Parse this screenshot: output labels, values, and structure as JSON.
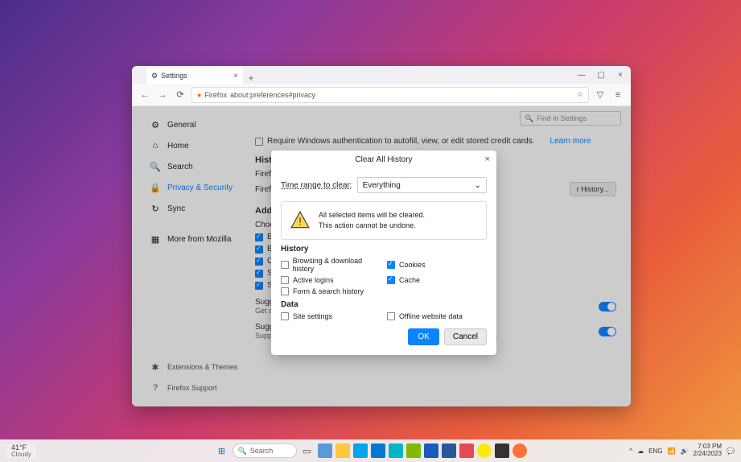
{
  "browser": {
    "tab_title": "Settings",
    "url_prefix": "Firefox",
    "url": "about:preferences#privacy",
    "find_placeholder": "Find in Settings"
  },
  "sidebar": {
    "items": [
      {
        "icon": "⚙",
        "label": "General"
      },
      {
        "icon": "⌂",
        "label": "Home"
      },
      {
        "icon": "🔍",
        "label": "Search"
      },
      {
        "icon": "🔒",
        "label": "Privacy & Security"
      },
      {
        "icon": "↻",
        "label": "Sync"
      },
      {
        "icon": "▦",
        "label": "More from Mozilla"
      }
    ],
    "footer": [
      {
        "icon": "✱",
        "label": "Extensions & Themes"
      },
      {
        "icon": "?",
        "label": "Firefox Support"
      }
    ]
  },
  "main": {
    "cc_label": "Require Windows authentication to autofill, view, or edit stored credit cards.",
    "learn_more": "Learn more",
    "history_heading": "Histo",
    "firefox_line1": "Firefo",
    "firefox_line2": "Firefo",
    "clear_history_btn": "r History...",
    "addr_heading": "Addr",
    "choose_line": "Choo",
    "chk1": "B",
    "chk2": "B",
    "chk3": "O",
    "chk4": "S",
    "chk5": "S",
    "sugg_heading": "Sugg",
    "sugg_desc": "Get suggestions from Firefox related to your search.",
    "sponsors_heading": "Suggestions from sponsors",
    "sponsors_desc": "Support the development of Firefox with occasional sponsored suggestions."
  },
  "dialog": {
    "title": "Clear All History",
    "range_label": "Time range to clear:",
    "range_value": "Everything",
    "warn_line1": "All selected items will be cleared.",
    "warn_line2": "This action cannot be undone.",
    "history_heading": "History",
    "chk_browsing": "Browsing & download history",
    "chk_cookies": "Cookies",
    "chk_logins": "Active logins",
    "chk_cache": "Cache",
    "chk_form": "Form & search history",
    "data_heading": "Data",
    "chk_site": "Site settings",
    "chk_offline": "Offline website data",
    "ok": "OK",
    "cancel": "Cancel"
  },
  "taskbar": {
    "temp": "41°F",
    "cond": "Cloudy",
    "search": "Search",
    "lang": "ENG",
    "time": "7:03 PM",
    "date": "2/24/2023"
  }
}
